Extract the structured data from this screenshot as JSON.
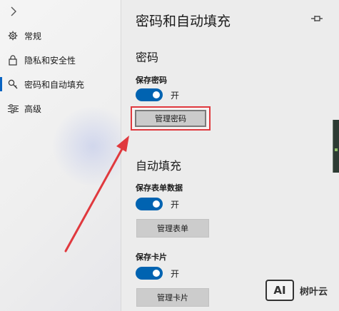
{
  "sidebar": {
    "items": [
      {
        "label": "常规",
        "icon": "gear-icon"
      },
      {
        "label": "隐私和安全性",
        "icon": "lock-icon"
      },
      {
        "label": "密码和自动填充",
        "icon": "key-search-icon",
        "active": true
      },
      {
        "label": "高级",
        "icon": "sliders-icon"
      }
    ]
  },
  "page": {
    "title": "密码和自动填充",
    "pin_icon": "pin-icon"
  },
  "password": {
    "section_title": "密码",
    "save_label": "保存密码",
    "toggle_state": "开",
    "toggle_on": true,
    "manage_button": "管理密码"
  },
  "autofill": {
    "section_title": "自动填充",
    "forms_label": "保存表单数据",
    "forms_toggle_state": "开",
    "forms_toggle_on": true,
    "forms_button": "管理表单",
    "cards_label": "保存卡片",
    "cards_toggle_state": "开",
    "cards_toggle_on": true,
    "cards_button": "管理卡片"
  },
  "watermark": {
    "logo_text": "AI",
    "brand_text": "树叶云"
  },
  "colors": {
    "accent": "#0063b1",
    "highlight_border": "#e0393e",
    "arrow": "#e0393e"
  }
}
